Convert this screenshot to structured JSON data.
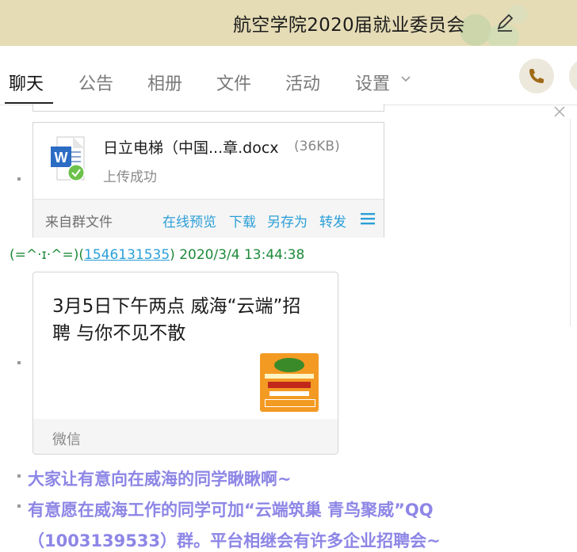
{
  "header": {
    "title": "航空学院2020届就业委员会",
    "edit_icon": "pencil-icon",
    "colors": {
      "background": "#e5dcb6"
    }
  },
  "tabs": [
    {
      "label": "聊天",
      "active": true
    },
    {
      "label": "公告",
      "active": false
    },
    {
      "label": "相册",
      "active": false
    },
    {
      "label": "文件",
      "active": false
    },
    {
      "label": "活动",
      "active": false
    },
    {
      "label": "设置",
      "active": false
    }
  ],
  "toolbar": {
    "call_icon": "phone-icon"
  },
  "file_card": {
    "name": "日立电梯（中国...章.docx",
    "size": "(36KB)",
    "status": "上传成功",
    "source": "来自群文件",
    "actions": [
      "在线预览",
      "下载",
      "另存为",
      "转发"
    ],
    "icon": "word-doc-icon"
  },
  "sender": {
    "name": "(=^·ɪ·^=)(",
    "qq": "1546131535",
    "rest": ") 2020/3/4 13:44:38"
  },
  "share_card": {
    "title": "3月5日下午两点 威海“云端”招聘 与你不见不散",
    "source": "微信"
  },
  "messages": [
    "大家让有意向在威海的同学瞅瞅啊~",
    "有意愿在威海工作的同学可加“云端筑巢 青鸟聚威”QQ",
    "（1003139533）群。平台相继会有许多企业招聘会~"
  ],
  "colors": {
    "link": "#2a9fd8",
    "sender": "#1e8a3a",
    "message": "#8d86e6"
  }
}
